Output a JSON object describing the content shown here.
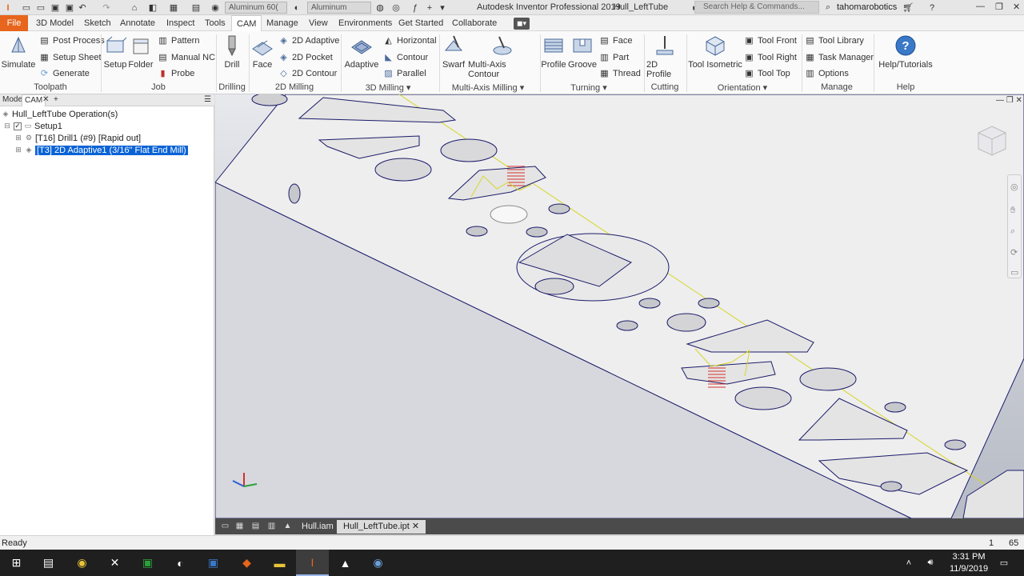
{
  "app_title": "Autodesk Inventor Professional 2019",
  "doc_title": "Hull_LeftTube",
  "qat": {
    "material": "Aluminum 60(",
    "appearance": "Aluminum",
    "search_placeholder": "Search Help & Commands...",
    "user": "tahomarobotics"
  },
  "menu_tabs": [
    "File",
    "3D Model",
    "Sketch",
    "Annotate",
    "Inspect",
    "Tools",
    "CAM",
    "Manage",
    "View",
    "Environments",
    "Get Started",
    "Collaborate"
  ],
  "ribbon": {
    "toolpath": {
      "label": "Toolpath",
      "simulate": "Simulate",
      "post_process": "Post Process",
      "setup_sheet": "Setup Sheet",
      "generate": "Generate"
    },
    "job": {
      "label": "Job",
      "setup": "Setup",
      "folder": "Folder",
      "pattern": "Pattern",
      "manual_nc": "Manual NC",
      "probe": "Probe"
    },
    "drilling": {
      "label": "Drilling",
      "drill": "Drill"
    },
    "milling2d": {
      "label": "2D Milling",
      "face": "Face",
      "adaptive2d": "2D Adaptive",
      "pocket2d": "2D Pocket",
      "contour2d": "2D Contour"
    },
    "milling3d": {
      "label": "3D Milling",
      "adaptive": "Adaptive",
      "horizontal": "Horizontal",
      "contour": "Contour",
      "parallel": "Parallel"
    },
    "multiaxis": {
      "label": "Multi-Axis Milling",
      "swarf": "Swarf",
      "multi_axis_contour": "Multi-Axis Contour"
    },
    "turning": {
      "label": "Turning",
      "profile": "Profile",
      "groove": "Groove",
      "face": "Face",
      "part": "Part",
      "thread": "Thread"
    },
    "cutting": {
      "label": "Cutting",
      "profile2d": "2D Profile"
    },
    "orientation": {
      "label": "Orientation",
      "tool_isometric": "Tool Isometric",
      "tool_front": "Tool Front",
      "tool_right": "Tool Right",
      "tool_top": "Tool Top"
    },
    "manage": {
      "label": "Manage",
      "tool_library": "Tool Library",
      "task_manager": "Task Manager",
      "options": "Options"
    },
    "help": {
      "label": "Help",
      "help_tutorials": "Help/Tutorials"
    }
  },
  "browser": {
    "tabs": [
      "Model",
      "CAM",
      "+"
    ],
    "root": "Hull_LeftTube Operation(s)",
    "setup": "Setup1",
    "op1": "[T16] Drill1 (#9) [Rapid out]",
    "op2": "[T3] 2D Adaptive1 (3/16\" Flat End Mill)"
  },
  "doc_tabs": [
    "Hull.iam",
    "Hull_LeftTube.ipt"
  ],
  "status": {
    "text": "Ready",
    "count1": "1",
    "count2": "65"
  },
  "taskbar": {
    "time": "3:31 PM",
    "date": "11/9/2019"
  },
  "colors": {
    "file_tab": "#e7651c",
    "selection": "#0a63d6",
    "part_face": "#eeeeee",
    "part_edge": "#1b1b6a",
    "toolpath": "#d6d62a",
    "drill_coil": "#d6302a"
  }
}
